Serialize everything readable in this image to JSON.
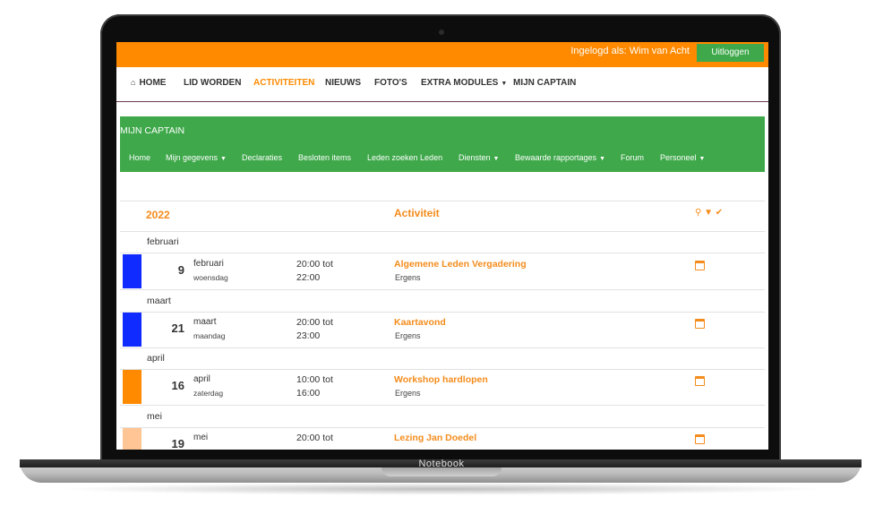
{
  "device": {
    "brand": "Notebook"
  },
  "colors": {
    "orange": "#ff8a00",
    "green": "#3ea84a",
    "blue": "#0f2bff",
    "peach": "#ffc594"
  },
  "topbar": {
    "login_text": "Ingelogd als: Wim van Acht",
    "logout_label": "Uitloggen"
  },
  "mainnav": {
    "items": [
      {
        "label": "HOME",
        "icon": "home-icon"
      },
      {
        "label": "LID WORDEN"
      },
      {
        "label": "ACTIVITEITEN",
        "active": true
      },
      {
        "label": "NIEUWS"
      },
      {
        "label": "FOTO'S"
      },
      {
        "label": "EXTRA MODULES",
        "dropdown": true
      },
      {
        "label": "MIJN CAPTAIN"
      }
    ]
  },
  "section": {
    "title": "MIJN CAPTAIN",
    "subnav": [
      {
        "label": "Home"
      },
      {
        "label": "Mijn gegevens",
        "dropdown": true
      },
      {
        "label": "Declaraties"
      },
      {
        "label": "Besloten items"
      },
      {
        "label": "Leden zoeken Leden"
      },
      {
        "label": "Diensten",
        "dropdown": true
      },
      {
        "label": "Bewaarde rapportages",
        "dropdown": true
      },
      {
        "label": "Forum"
      },
      {
        "label": "Personeel",
        "dropdown": true
      }
    ]
  },
  "table": {
    "year": "2022",
    "activity_header": "Activiteit",
    "header_icons": [
      "search-icon",
      "filter-icon",
      "check-circle-icon"
    ],
    "months": [
      "februari",
      "maart",
      "april",
      "mei"
    ],
    "events": [
      {
        "day": "9",
        "month": "februari",
        "weekday": "woensdag",
        "start": "20:00 tot",
        "end": "22:00",
        "title": "Algemene Leden Vergadering",
        "location": "Ergens",
        "color": "#0f2bff"
      },
      {
        "day": "21",
        "month": "maart",
        "weekday": "maandag",
        "start": "20:00 tot",
        "end": "23:00",
        "title": "Kaartavond",
        "location": "Ergens",
        "color": "#0f2bff"
      },
      {
        "day": "16",
        "month": "april",
        "weekday": "zaterdag",
        "start": "10:00 tot",
        "end": "16:00",
        "title": "Workshop hardlopen",
        "location": "Ergens",
        "color": "#ff8a00"
      },
      {
        "day": "19",
        "month": "mei",
        "weekday": "",
        "start": "20:00 tot",
        "end": "",
        "title": "Lezing Jan Doedel",
        "location": "",
        "color": "#ffc594"
      }
    ]
  }
}
